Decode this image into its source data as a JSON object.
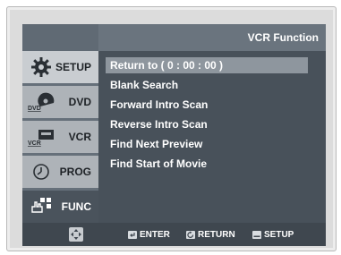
{
  "screen": {
    "title": "VCR Function"
  },
  "sidebar": {
    "items": [
      {
        "label": "SETUP",
        "icon": "gear-icon"
      },
      {
        "label": "DVD",
        "icon": "dvd-disc-icon"
      },
      {
        "label": "VCR",
        "icon": "vcr-tape-icon"
      },
      {
        "label": "PROG",
        "icon": "clock-icon"
      },
      {
        "label": "FUNC",
        "icon": "hand-grid-icon",
        "active": true
      }
    ]
  },
  "menu": {
    "items": [
      {
        "label": "Return to ( 0 : 00 : 00 )",
        "selected": true
      },
      {
        "label": "Blank Search"
      },
      {
        "label": "Forward Intro Scan"
      },
      {
        "label": "Reverse Intro Scan"
      },
      {
        "label": "Find Next Preview"
      },
      {
        "label": "Find Start of Movie"
      }
    ]
  },
  "footer": {
    "hints": [
      {
        "label": "ENTER",
        "icon": "enter-icon"
      },
      {
        "label": "RETURN",
        "icon": "return-icon"
      },
      {
        "label": "SETUP",
        "icon": "setup-icon"
      }
    ],
    "nav_icon": "dpad-arrows-icon"
  },
  "colors": {
    "screen_bg": "#48515a",
    "selected_bg": "#8e969e",
    "text": "#ffffff"
  }
}
